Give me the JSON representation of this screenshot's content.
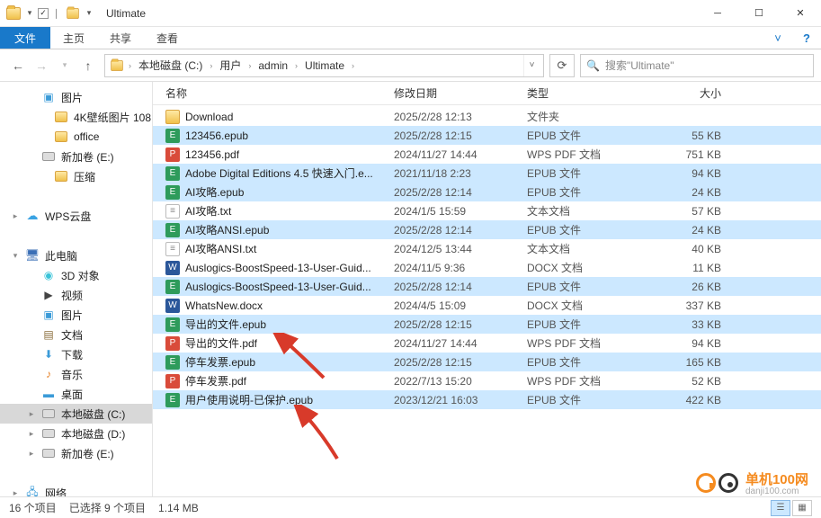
{
  "window": {
    "title": "Ultimate"
  },
  "ribbon": {
    "file": "文件",
    "tabs": [
      "主页",
      "共享",
      "查看"
    ]
  },
  "breadcrumb": {
    "segments": [
      "本地磁盘 (C:)",
      "用户",
      "admin",
      "Ultimate"
    ]
  },
  "search": {
    "placeholder": "搜索\"Ultimate\""
  },
  "navpane": {
    "items": [
      {
        "label": "图片",
        "indent": 1,
        "icon": "pictures",
        "exp": ""
      },
      {
        "label": "4K壁纸图片 108",
        "indent": 2,
        "icon": "folder",
        "exp": ""
      },
      {
        "label": "office",
        "indent": 2,
        "icon": "folder",
        "exp": ""
      },
      {
        "label": "新加卷 (E:)",
        "indent": 1,
        "icon": "drive",
        "exp": ""
      },
      {
        "label": "压缩",
        "indent": 2,
        "icon": "folder",
        "exp": ""
      },
      {
        "label": "",
        "indent": 0,
        "icon": "",
        "exp": ""
      },
      {
        "label": "WPS云盘",
        "indent": 0,
        "icon": "cloud",
        "exp": "▸"
      },
      {
        "label": "",
        "indent": 0,
        "icon": "",
        "exp": ""
      },
      {
        "label": "此电脑",
        "indent": 0,
        "icon": "pc",
        "exp": "▾"
      },
      {
        "label": "3D 对象",
        "indent": 1,
        "icon": "3d",
        "exp": ""
      },
      {
        "label": "视频",
        "indent": 1,
        "icon": "video",
        "exp": ""
      },
      {
        "label": "图片",
        "indent": 1,
        "icon": "pictures",
        "exp": ""
      },
      {
        "label": "文档",
        "indent": 1,
        "icon": "docs",
        "exp": ""
      },
      {
        "label": "下载",
        "indent": 1,
        "icon": "download",
        "exp": ""
      },
      {
        "label": "音乐",
        "indent": 1,
        "icon": "music",
        "exp": ""
      },
      {
        "label": "桌面",
        "indent": 1,
        "icon": "desktop",
        "exp": ""
      },
      {
        "label": "本地磁盘 (C:)",
        "indent": 1,
        "icon": "drive",
        "exp": "▸",
        "sel": true
      },
      {
        "label": "本地磁盘 (D:)",
        "indent": 1,
        "icon": "drive",
        "exp": "▸"
      },
      {
        "label": "新加卷 (E:)",
        "indent": 1,
        "icon": "drive",
        "exp": "▸"
      },
      {
        "label": "",
        "indent": 0,
        "icon": "",
        "exp": ""
      },
      {
        "label": "网络",
        "indent": 0,
        "icon": "net",
        "exp": "▸"
      }
    ]
  },
  "columns": {
    "name": "名称",
    "date": "修改日期",
    "type": "类型",
    "size": "大小"
  },
  "files": [
    {
      "name": "Download",
      "date": "2025/2/28 12:13",
      "type": "文件夹",
      "size": "",
      "icon": "folder",
      "sel": false
    },
    {
      "name": "123456.epub",
      "date": "2025/2/28 12:15",
      "type": "EPUB 文件",
      "size": "55 KB",
      "icon": "epub",
      "sel": true
    },
    {
      "name": "123456.pdf",
      "date": "2024/11/27 14:44",
      "type": "WPS PDF 文档",
      "size": "751 KB",
      "icon": "pdf",
      "sel": false
    },
    {
      "name": "Adobe Digital Editions 4.5 快速入门.e...",
      "date": "2021/11/18 2:23",
      "type": "EPUB 文件",
      "size": "94 KB",
      "icon": "epub",
      "sel": true
    },
    {
      "name": "AI攻略.epub",
      "date": "2025/2/28 12:14",
      "type": "EPUB 文件",
      "size": "24 KB",
      "icon": "epub",
      "sel": true
    },
    {
      "name": "AI攻略.txt",
      "date": "2024/1/5 15:59",
      "type": "文本文档",
      "size": "57 KB",
      "icon": "txt",
      "sel": false
    },
    {
      "name": "AI攻略ANSI.epub",
      "date": "2025/2/28 12:14",
      "type": "EPUB 文件",
      "size": "24 KB",
      "icon": "epub",
      "sel": true
    },
    {
      "name": "AI攻略ANSI.txt",
      "date": "2024/12/5 13:44",
      "type": "文本文档",
      "size": "40 KB",
      "icon": "txt",
      "sel": false
    },
    {
      "name": "Auslogics-BoostSpeed-13-User-Guid...",
      "date": "2024/11/5 9:36",
      "type": "DOCX 文档",
      "size": "11 KB",
      "icon": "docx",
      "sel": false
    },
    {
      "name": "Auslogics-BoostSpeed-13-User-Guid...",
      "date": "2025/2/28 12:14",
      "type": "EPUB 文件",
      "size": "26 KB",
      "icon": "epub",
      "sel": true
    },
    {
      "name": "WhatsNew.docx",
      "date": "2024/4/5 15:09",
      "type": "DOCX 文档",
      "size": "337 KB",
      "icon": "docx",
      "sel": false
    },
    {
      "name": "导出的文件.epub",
      "date": "2025/2/28 12:15",
      "type": "EPUB 文件",
      "size": "33 KB",
      "icon": "epub",
      "sel": true
    },
    {
      "name": "导出的文件.pdf",
      "date": "2024/11/27 14:44",
      "type": "WPS PDF 文档",
      "size": "94 KB",
      "icon": "pdf",
      "sel": false
    },
    {
      "name": "停车发票.epub",
      "date": "2025/2/28 12:15",
      "type": "EPUB 文件",
      "size": "165 KB",
      "icon": "epub",
      "sel": true
    },
    {
      "name": "停车发票.pdf",
      "date": "2022/7/13 15:20",
      "type": "WPS PDF 文档",
      "size": "52 KB",
      "icon": "pdf",
      "sel": false
    },
    {
      "name": "用户使用说明-已保护.epub",
      "date": "2023/12/21 16:03",
      "type": "EPUB 文件",
      "size": "422 KB",
      "icon": "epub",
      "sel": true
    }
  ],
  "status": {
    "total": "16 个项目",
    "selected": "已选择 9 个项目",
    "size": "1.14 MB"
  },
  "watermark": {
    "brand": "单机100网",
    "sub": "danji100.com"
  }
}
